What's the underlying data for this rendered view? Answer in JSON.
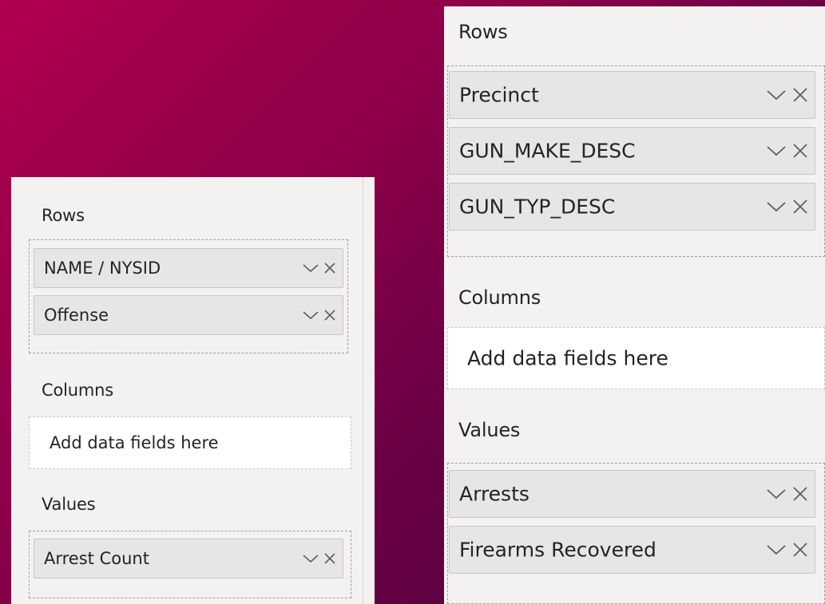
{
  "left_panel": {
    "rows_label": "Rows",
    "rows_fields": [
      {
        "name": "NAME / NYSID"
      },
      {
        "name": "Offense"
      }
    ],
    "columns_label": "Columns",
    "columns_placeholder": "Add data fields here",
    "values_label": "Values",
    "values_fields": [
      {
        "name": "Arrest Count"
      }
    ]
  },
  "right_panel": {
    "rows_label": "Rows",
    "rows_fields": [
      {
        "name": "Precinct"
      },
      {
        "name": "GUN_MAKE_DESC"
      },
      {
        "name": "GUN_TYP_DESC"
      }
    ],
    "columns_label": "Columns",
    "columns_placeholder": "Add data fields here",
    "values_label": "Values",
    "values_fields": [
      {
        "name": "Arrests"
      },
      {
        "name": "Firearms Recovered"
      }
    ]
  },
  "icons": {
    "expand": "chevron-down-icon",
    "remove": "close-icon"
  },
  "colors": {
    "background_start": "#b0004f",
    "background_end": "#4a0a3a",
    "panel": "#f3f2f1",
    "field": "#e6e6e6",
    "text": "#252423"
  }
}
